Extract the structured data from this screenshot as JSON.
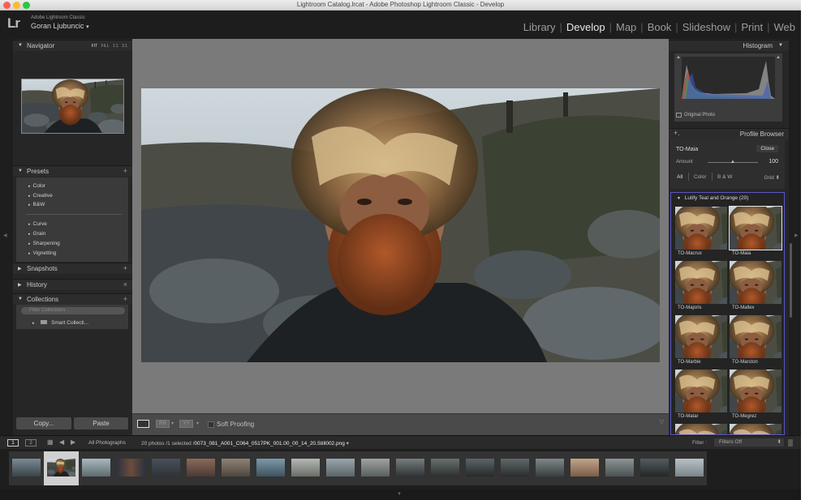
{
  "window": {
    "title": "Lightroom Catalog.lrcat - Adobe Photoshop Lightroom Classic - Develop"
  },
  "identity": {
    "logo": "Lr",
    "app_name": "Adobe Lightroom Classic",
    "user": "Goran Ljubuncic"
  },
  "modules": [
    "Library",
    "Develop",
    "Map",
    "Book",
    "Slideshow",
    "Print",
    "Web"
  ],
  "active_module": "Develop",
  "left_panel": {
    "navigator": {
      "title": "Navigator",
      "modes": [
        "FIT",
        "FILL",
        "1:1",
        "3:1"
      ]
    },
    "presets": {
      "title": "Presets",
      "items": [
        "Color",
        "Creative",
        "B&W",
        "Curve",
        "Grain",
        "Sharpening",
        "Vignetting"
      ]
    },
    "snapshots": {
      "title": "Snapshots"
    },
    "history": {
      "title": "History"
    },
    "collections": {
      "title": "Collections",
      "filter_placeholder": "Filter Collections",
      "items": [
        "Smart Collecti..."
      ]
    },
    "copy_label": "Copy...",
    "paste_label": "Paste"
  },
  "toolbar": {
    "soft_proofing": "Soft Proofing"
  },
  "right_panel": {
    "histogram": {
      "title": "Histogram",
      "original_photo": "Original Photo"
    },
    "profile_browser": {
      "title": "Profile Browser",
      "current": "TO-Maia",
      "close_label": "Close",
      "amount_label": "Amount",
      "amount_value": "100",
      "amount_fraction": 0.5,
      "filters": [
        "All",
        "Color",
        "B & W"
      ],
      "view": "Grid"
    },
    "group": {
      "title": "Lutify Teal and Orange (20)",
      "profiles": [
        "TO-Macrux",
        "TO-Maia",
        "TO-Majoris",
        "TO-Mallex",
        "TO-Marble",
        "TO-Marston",
        "TO-Matar",
        "TO-Megrez"
      ],
      "selected": "TO-Maia"
    }
  },
  "filmstrip_bar": {
    "pages": [
      "1",
      "2"
    ],
    "source": "All Photographs",
    "count": "20 photos /1 selected /",
    "filename": "0073_081_A001_C064_0517PK_001.00_00_14_20.Still002.png",
    "filter_label": "Filter :",
    "filter_value": "Filters Off"
  },
  "colors": {
    "accent": "#5b57c6",
    "panel": "#262626",
    "canvas": "#7a7a7a"
  },
  "icons": [
    "triangle-down-icon",
    "plus-icon",
    "close-icon",
    "grid-icon",
    "arrow-left-icon",
    "arrow-right-icon",
    "dropdown-icon"
  ]
}
